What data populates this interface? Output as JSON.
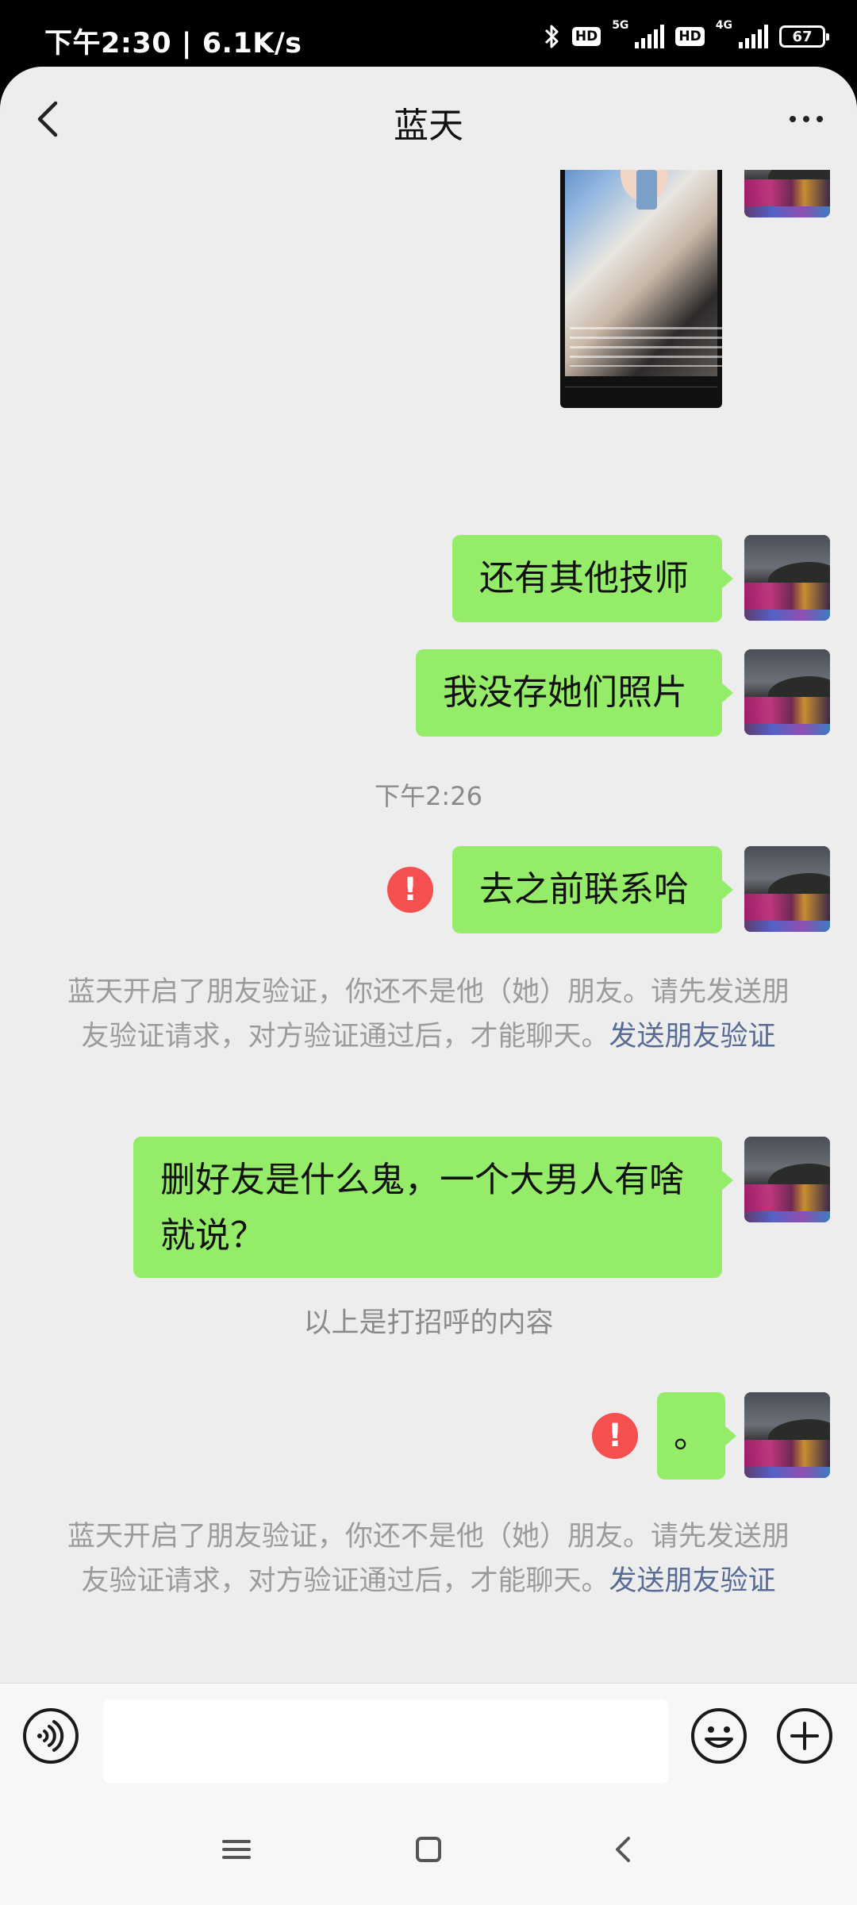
{
  "status_bar": {
    "time": "下午2:30 | 6.1K/s",
    "network_1": "5G",
    "network_2": "4G",
    "hd_label": "HD",
    "battery": "67"
  },
  "header": {
    "title": "蓝天",
    "back_icon": "chevron-left-icon",
    "more_icon": "more-horizontal-icon"
  },
  "messages": [
    {
      "type": "image",
      "from": "me",
      "description_icon": "image-message"
    },
    {
      "type": "text",
      "from": "me",
      "text": "还有其他技师"
    },
    {
      "type": "text",
      "from": "me",
      "text": "我没存她们照片"
    },
    {
      "type": "timestamp",
      "text": "下午2:26"
    },
    {
      "type": "text",
      "from": "me",
      "text": "去之前联系哈",
      "failed": true,
      "failed_mark": "!"
    },
    {
      "type": "system",
      "text": "蓝天开启了朋友验证，你还不是他（她）朋友。请先发送朋友验证请求，对方验证通过后，才能聊天。",
      "link": "发送朋友验证"
    },
    {
      "type": "text",
      "from": "me",
      "text": "删好友是什么鬼，一个大男人有啥就说？"
    },
    {
      "type": "notice",
      "text": "以上是打招呼的内容"
    },
    {
      "type": "text",
      "from": "me",
      "text": "。",
      "failed": true,
      "failed_mark": "!"
    },
    {
      "type": "system",
      "text": "蓝天开启了朋友验证，你还不是他（她）朋友。请先发送朋友验证请求，对方验证通过后，才能聊天。",
      "link": "发送朋友验证"
    }
  ],
  "input_bar": {
    "value": "",
    "voice_icon": "voice-icon",
    "emoji_icon": "emoji-icon",
    "plus_icon": "plus-icon"
  },
  "system_nav": {
    "menu_icon": "menu-icon",
    "home_icon": "home-icon",
    "back_icon": "back-icon"
  },
  "colors": {
    "bubble": "#95ec69",
    "background": "#ededed",
    "error": "#f55050",
    "link": "#576b95"
  }
}
